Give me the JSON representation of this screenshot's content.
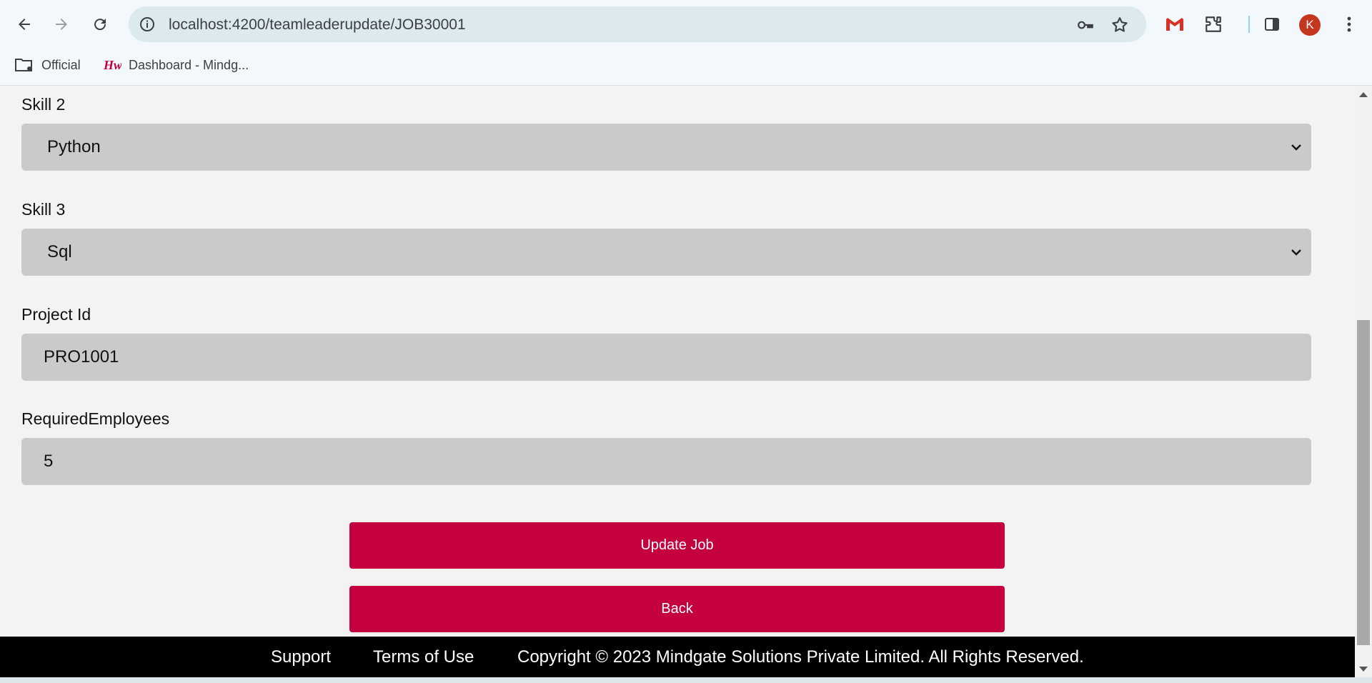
{
  "browser": {
    "url": "localhost:4200/teamleaderupdate/JOB30001",
    "avatar_letter": "K",
    "bookmarks": [
      {
        "label": "Official",
        "icon": "folder-settings-icon"
      },
      {
        "label": "Dashboard - Mindg...",
        "icon": "hw-logo-icon"
      }
    ]
  },
  "form": {
    "skill2": {
      "label": "Skill 2",
      "value": "Python"
    },
    "skill3": {
      "label": "Skill 3",
      "value": "Sql"
    },
    "project_id": {
      "label": "Project Id",
      "value": "PRO1001"
    },
    "required_employees": {
      "label": "RequiredEmployees",
      "value": "5"
    }
  },
  "buttons": {
    "update": "Update Job",
    "back": "Back"
  },
  "footer": {
    "support": "Support",
    "terms": "Terms of Use",
    "copyright": "Copyright © 2023 Mindgate Solutions Private Limited. All Rights Reserved."
  },
  "colors": {
    "accent": "#c4003f",
    "field_bg": "#cacaca",
    "footer_bg": "#000000"
  }
}
